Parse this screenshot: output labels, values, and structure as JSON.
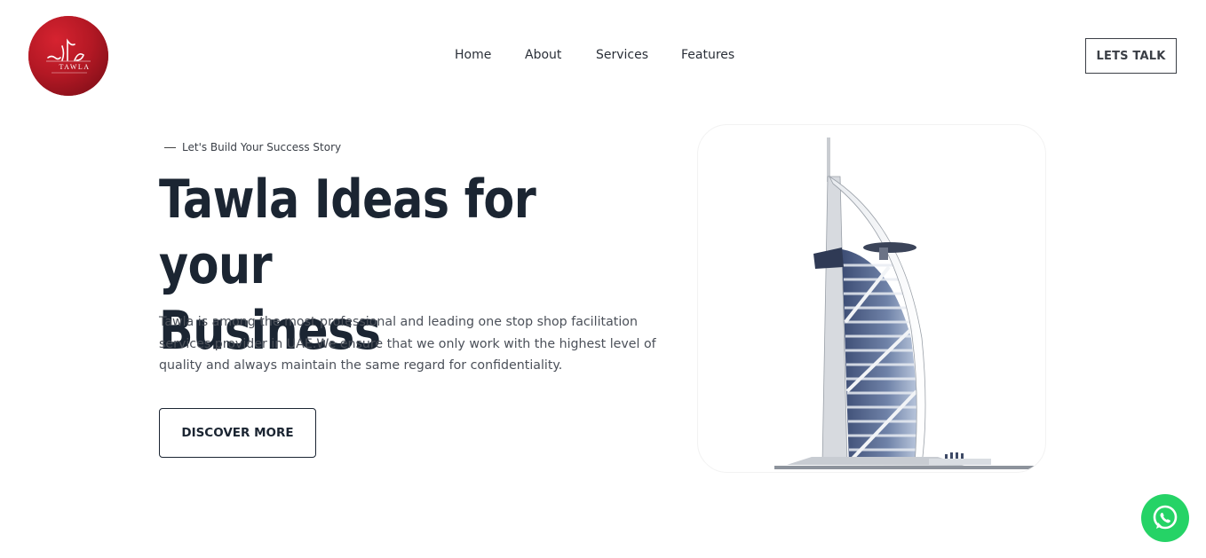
{
  "header": {
    "logo": {
      "alt": "Tawla logo",
      "brand_text": "TAWLA",
      "brand_color": "#b31824"
    },
    "nav": [
      {
        "label": "Home"
      },
      {
        "label": "About"
      },
      {
        "label": "Services"
      },
      {
        "label": "Features"
      }
    ],
    "cta_label": "LETS TALK"
  },
  "hero": {
    "tagline": "Let's Build Your Success Story",
    "title_line1": "Tawla Ideas for your",
    "title_line2": "Business",
    "description": "Tawla is among the most professional and leading one stop shop facilitation services provider in UAE.We ensure that we only work with the highest level of quality and always maintain the same regard for confidentiality.",
    "button_label": "DISCOVER MORE",
    "image": {
      "subject": "Burj Al Arab building illustration"
    }
  },
  "floating": {
    "whatsapp": {
      "icon": "whatsapp-icon",
      "color": "#25d366"
    }
  },
  "colors": {
    "heading": "#1b2532",
    "body_text": "#4b5059",
    "accent_red": "#b31824"
  }
}
